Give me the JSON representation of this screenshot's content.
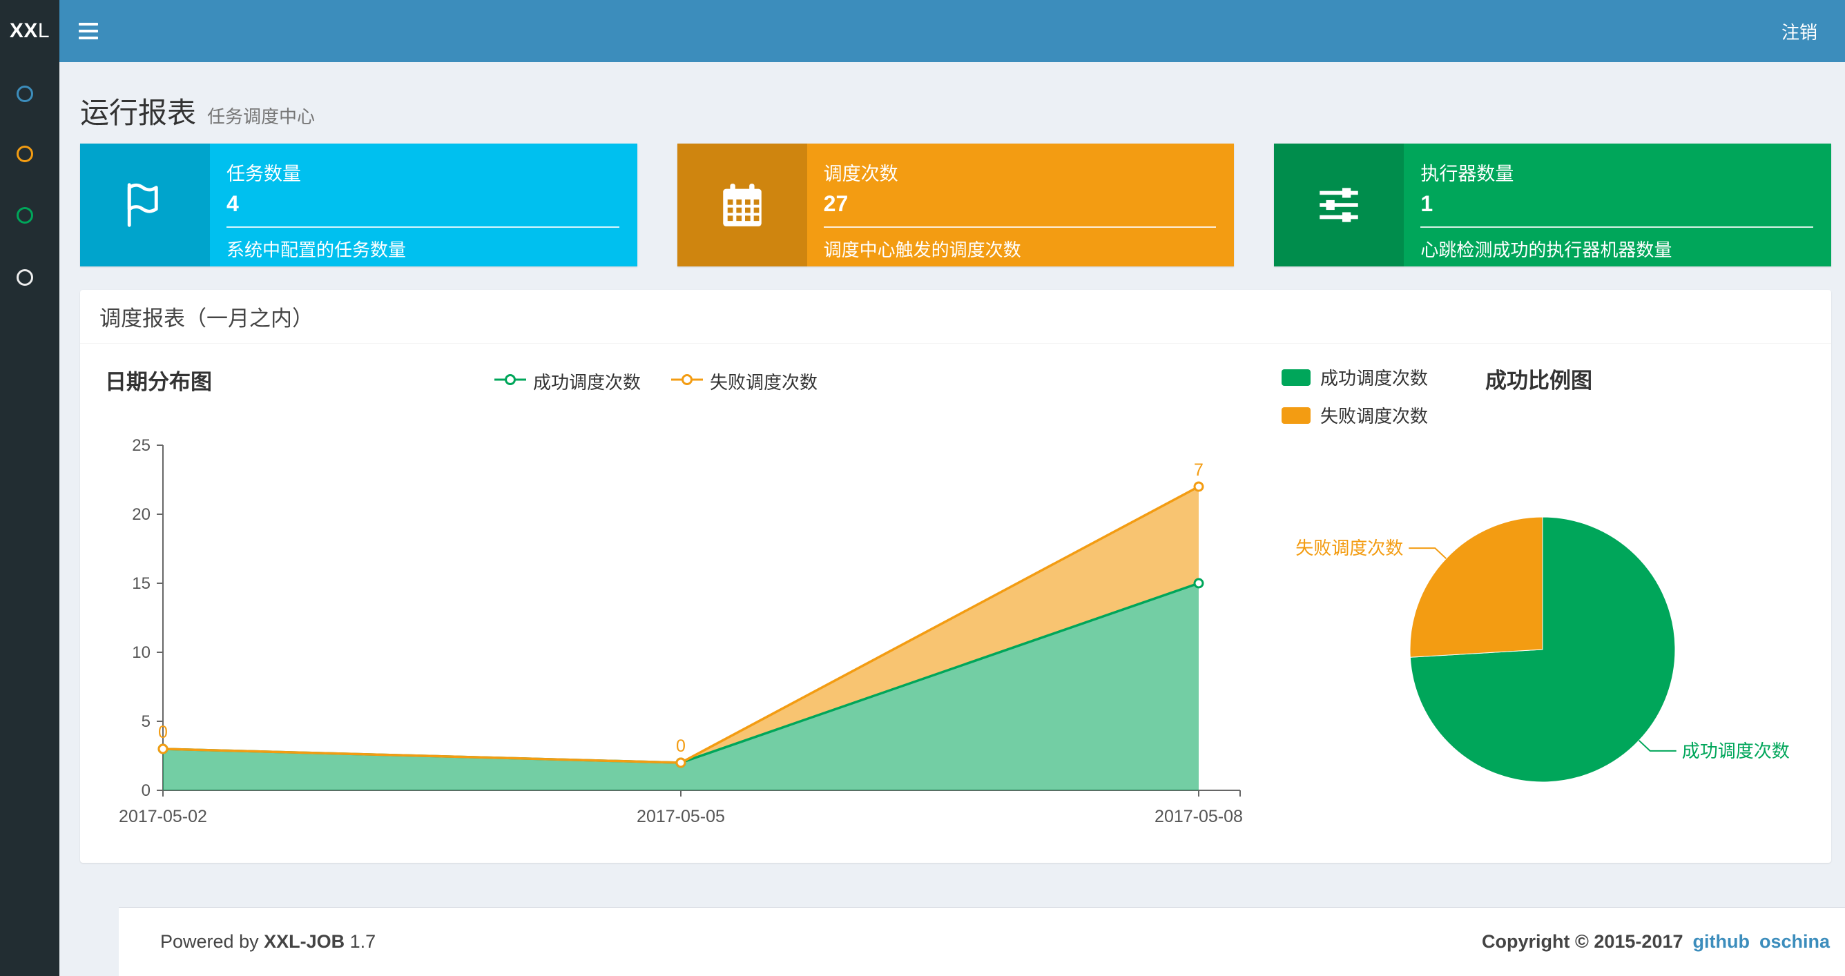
{
  "navbar": {
    "logo_bold": "XX",
    "logo_rest": "L",
    "logout_label": "注销"
  },
  "sidebar": {
    "items": [
      {
        "icon": "circle-icon",
        "color": "#3c8dbc"
      },
      {
        "icon": "circle-icon",
        "color": "#f39c12"
      },
      {
        "icon": "circle-icon",
        "color": "#00a65a"
      },
      {
        "icon": "circle-icon",
        "color": "#eeeeee"
      }
    ]
  },
  "page_header": {
    "title": "运行报表",
    "subtitle": "任务调度中心"
  },
  "info_boxes": [
    {
      "icon": "flag-icon",
      "label": "任务数量",
      "value": "4",
      "desc": "系统中配置的任务数量",
      "color": "#00c0ef",
      "icon_bg": "#00a4cc"
    },
    {
      "icon": "calendar-icon",
      "label": "调度次数",
      "value": "27",
      "desc": "调度中心触发的调度次数",
      "color": "#f39c12",
      "icon_bg": "#cf850f"
    },
    {
      "icon": "sliders-icon",
      "label": "执行器数量",
      "value": "1",
      "desc": "心跳检测成功的执行器机器数量",
      "color": "#00a65a",
      "icon_bg": "#008d4c"
    }
  ],
  "panel": {
    "title": "调度报表（一月之内）"
  },
  "chart_data": [
    {
      "type": "area",
      "title": "日期分布图",
      "categories": [
        "2017-05-02",
        "2017-05-05",
        "2017-05-08"
      ],
      "series": [
        {
          "name": "成功调度次数",
          "values": [
            3,
            2,
            15
          ],
          "color": "#00a65a",
          "show_labels": false
        },
        {
          "name": "失败调度次数",
          "values": [
            0,
            0,
            7
          ],
          "color": "#f39c12",
          "show_labels": true
        }
      ],
      "stacked": true,
      "xlabel": "",
      "ylabel": "",
      "ylim": [
        0,
        25
      ],
      "yticks": [
        0,
        5,
        10,
        15,
        20,
        25
      ],
      "grid": false,
      "legend_position": "top"
    },
    {
      "type": "pie",
      "title": "成功比例图",
      "slices": [
        {
          "name": "成功调度次数",
          "value": 20,
          "color": "#00a65a"
        },
        {
          "name": "失败调度次数",
          "value": 7,
          "color": "#f39c12"
        }
      ],
      "legend_position": "top-left"
    }
  ],
  "footer": {
    "powered_prefix": "Powered by",
    "product": "XXL-JOB",
    "version": "1.7",
    "copyright": "Copyright © 2015-2017",
    "links": [
      "github",
      "oschina"
    ]
  }
}
